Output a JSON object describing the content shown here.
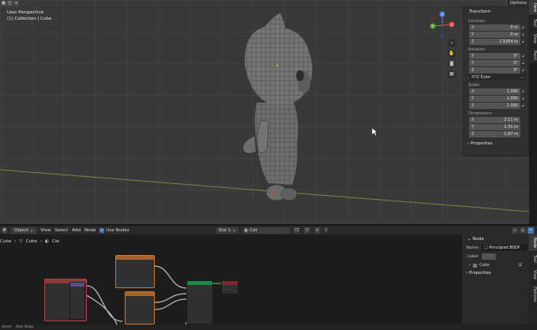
{
  "viewport": {
    "header_icons": [
      "viewport-mode-icon",
      "select-mode-icon",
      "add-icon"
    ],
    "options_label": "Options",
    "info_line1": "User Perspective",
    "info_line2": "(1) Collection | Cube",
    "gizmo_axes": {
      "x": "X",
      "y": "Y",
      "z": "Z"
    },
    "tools": [
      "zoom-icon",
      "pan-icon",
      "camera-icon",
      "grid-icon"
    ]
  },
  "npanel": {
    "title": "Transform",
    "location_label": "Location:",
    "location": [
      {
        "axis": "X",
        "value": "0 m"
      },
      {
        "axis": "Y",
        "value": "0 m"
      },
      {
        "axis": "Z",
        "value": "2.9354 m"
      }
    ],
    "rotation_label": "Rotation:",
    "rotation": [
      {
        "axis": "X",
        "value": "0°"
      },
      {
        "axis": "Y",
        "value": "0°"
      },
      {
        "axis": "Z",
        "value": "0°"
      }
    ],
    "rotation_mode": "XYZ Euler",
    "scale_label": "Scale:",
    "scale": [
      {
        "axis": "X",
        "value": "1.000"
      },
      {
        "axis": "Y",
        "value": "1.000"
      },
      {
        "axis": "Z",
        "value": "1.000"
      }
    ],
    "dimensions_label": "Dimensions:",
    "dimensions": [
      {
        "axis": "X",
        "value": "2.11 m"
      },
      {
        "axis": "Y",
        "value": "1.41 m"
      },
      {
        "axis": "Z",
        "value": "1.87 m"
      }
    ],
    "properties_label": "Properties"
  },
  "side_tabs_top": [
    "Item",
    "Tool",
    "View",
    "Paint"
  ],
  "node_editor": {
    "mode": "Object",
    "menus": [
      "View",
      "Select",
      "Add",
      "Node"
    ],
    "use_nodes_label": "Use Nodes",
    "slot": "Slot 1",
    "material": "Cat",
    "breadcrumb": [
      "Cube",
      "Cube",
      "Cat"
    ]
  },
  "node_sidebar": {
    "title": "Node",
    "name_label": "Name:",
    "name_value": "Principled BSDF",
    "label_label": "Label:",
    "label_value": "",
    "color_label": "Color",
    "properties_label": "Properties"
  },
  "side_tabs_bottom": [
    "Node",
    "Tool",
    "View",
    "Options"
  ],
  "statusbar": [
    "ancel",
    "Axis Snap"
  ],
  "colors": {
    "accent": "#4772b3",
    "selected_node": "#d1763b",
    "shader_header": "#1c8a44"
  }
}
